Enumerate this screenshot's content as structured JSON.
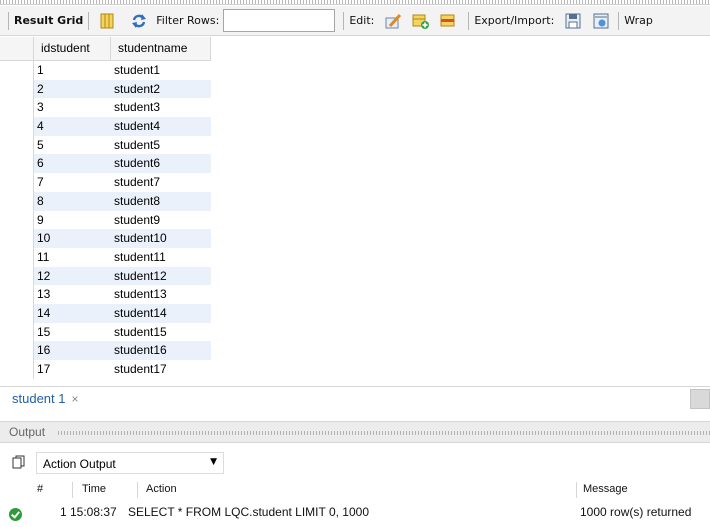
{
  "toolbar": {
    "result_grid_label": "Result Grid",
    "filter_rows_label": "Filter Rows:",
    "filter_value": "",
    "edit_label": "Edit:",
    "export_import_label": "Export/Import:",
    "wrap_label": "Wrap"
  },
  "grid": {
    "columns": [
      "idstudent",
      "studentname"
    ],
    "rows": [
      [
        "1",
        "student1"
      ],
      [
        "2",
        "student2"
      ],
      [
        "3",
        "student3"
      ],
      [
        "4",
        "student4"
      ],
      [
        "5",
        "student5"
      ],
      [
        "6",
        "student6"
      ],
      [
        "7",
        "student7"
      ],
      [
        "8",
        "student8"
      ],
      [
        "9",
        "student9"
      ],
      [
        "10",
        "student10"
      ],
      [
        "11",
        "student11"
      ],
      [
        "12",
        "student12"
      ],
      [
        "13",
        "student13"
      ],
      [
        "14",
        "student14"
      ],
      [
        "15",
        "student15"
      ],
      [
        "16",
        "student16"
      ],
      [
        "17",
        "student17"
      ]
    ]
  },
  "tabs": [
    {
      "label": "student 1",
      "close": "×"
    }
  ],
  "output": {
    "title": "Output",
    "selector_value": "Action Output",
    "columns": {
      "num": "#",
      "time": "Time",
      "action": "Action",
      "message": "Message"
    },
    "rows": [
      {
        "num": "1",
        "time": "15:08:37",
        "action": "SELECT * FROM LQC.student LIMIT 0, 1000",
        "message": "1000 row(s) returned",
        "status": "success"
      }
    ]
  },
  "colors": {
    "accent": "#1d5fa8",
    "row_alt": "#eaf1fb",
    "success": "#2e9b3a"
  }
}
